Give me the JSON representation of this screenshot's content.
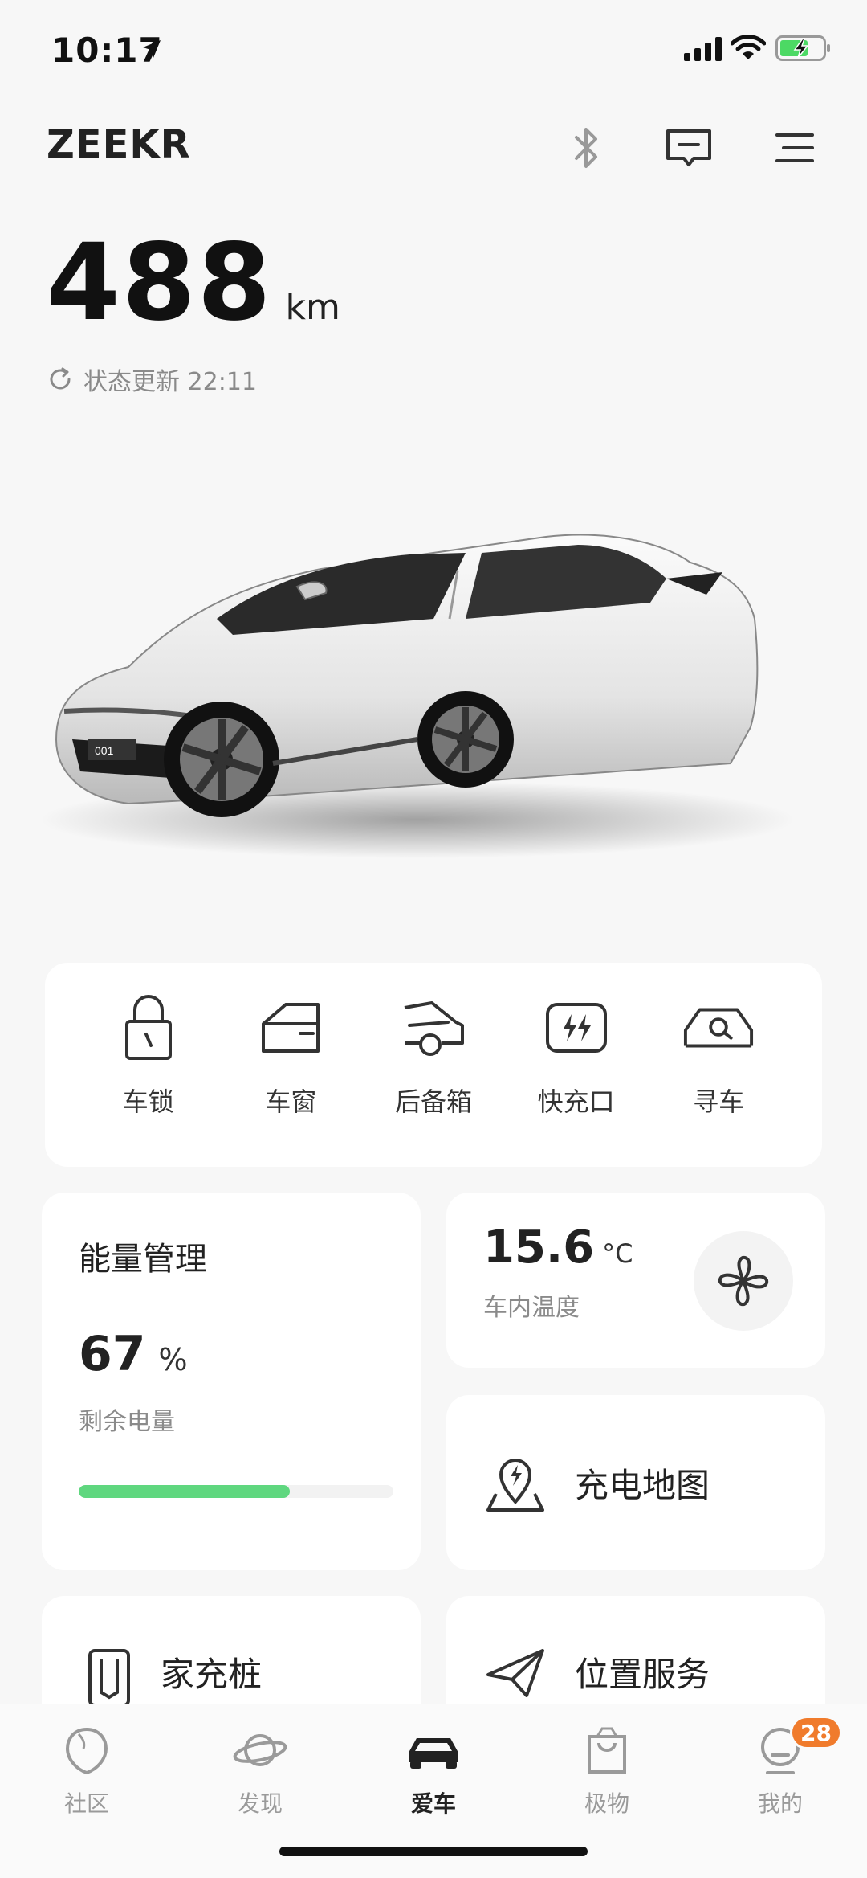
{
  "status_bar": {
    "time": "10:17"
  },
  "header": {
    "brand": "ZEEKR"
  },
  "range": {
    "value": "488",
    "unit": "km",
    "update_label": "状态更新 22:11"
  },
  "controls": [
    {
      "label": "车锁",
      "icon": "lock-icon"
    },
    {
      "label": "车窗",
      "icon": "car-window-icon"
    },
    {
      "label": "后备箱",
      "icon": "trunk-icon"
    },
    {
      "label": "快充口",
      "icon": "fast-charge-port-icon"
    },
    {
      "label": "寻车",
      "icon": "find-car-icon"
    }
  ],
  "energy": {
    "title": "能量管理",
    "percent": "67",
    "percent_unit": "%",
    "subtitle": "剩余电量",
    "battery_level": 0.67
  },
  "climate": {
    "temperature": "15.6",
    "unit": "°C",
    "subtitle": "车内温度"
  },
  "charging_map": {
    "label": "充电地图"
  },
  "home_charger": {
    "label": "家充桩"
  },
  "location_service": {
    "label": "位置服务"
  },
  "tabs": [
    {
      "label": "社区",
      "active": false
    },
    {
      "label": "发现",
      "active": false
    },
    {
      "label": "爱车",
      "active": true
    },
    {
      "label": "极物",
      "active": false
    },
    {
      "label": "我的",
      "active": false,
      "badge": "28"
    }
  ],
  "colors": {
    "battery_fill": "#5fd77f",
    "badge": "#f07b2c"
  }
}
